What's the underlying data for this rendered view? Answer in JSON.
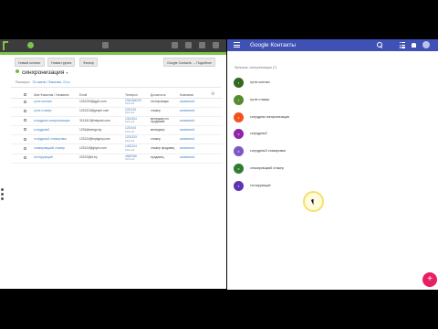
{
  "crm": {
    "buttons": {
      "new_contact": "Новый контакт",
      "new_segment": "Новая группа",
      "filter": "Фильтр",
      "google_sync": "Google Contacts → Подобное"
    },
    "title": "синхронизация",
    "subtitle_label": "Расширил",
    "subtitle_link": "По имени / Фамилии, 24 ст.",
    "columns": [
      "Имя Фамилия / Название",
      "Email",
      "Телефон",
      "Должность",
      "Компания"
    ],
    "rows": [
      {
        "name": "гугле контакт",
        "email": "1231233@gg1l.com",
        "phone": "2342466767",
        "phone_type": "Рабочий",
        "job": "тестировщик",
        "company": "компания1"
      },
      {
        "name": "гугле стажер",
        "email": "1231313@gmym.com",
        "phone": "123/133",
        "phone_type": "Рабочий",
        "job": "стажер",
        "company": "компания1"
      },
      {
        "name": "сотрудник синхронизация",
        "email": "3113413@mkpmk.com",
        "phone": "1341344",
        "phone_type": "Рабочий",
        "job": "менеджер по продажам",
        "company": "компания1"
      },
      {
        "name": "сотрудник2",
        "email": "1234@mmga.by",
        "phone": "123/144",
        "phone_type": "Рабочий",
        "job": "менеджер",
        "company": "компания1"
      },
      {
        "name": "сотрудник3 стажировки",
        "email": "123124@mykgmy.com",
        "phone": "1231233",
        "phone_type": "Рабочий",
        "job": "стажер",
        "company": "компания1"
      },
      {
        "name": "стажировщик5 стажер",
        "email": "123124@ghym.com",
        "phone": "1432124",
        "phone_type": "Рабочий",
        "job": "стажер продавец",
        "company": "компания1"
      },
      {
        "name": "тестирующий",
        "email": "22222@br.by",
        "phone": "4565766",
        "phone_type": "Рабочий",
        "job": "продавец",
        "company": "компания1"
      }
    ]
  },
  "gc": {
    "app_title_brand": "Google",
    "app_title_product": "Контакты",
    "section_title": "Ярлыков: синхронизация (7)",
    "contacts": [
      {
        "initial": "г",
        "name": "гугле контакт",
        "color": "#33691e"
      },
      {
        "initial": "г",
        "name": "гугле стажер",
        "color": "#558b2f"
      },
      {
        "initial": "с",
        "name": "сотрудник синхронизация",
        "color": "#f4511e"
      },
      {
        "initial": "с",
        "name": "сотрудник2",
        "color": "#8e24aa"
      },
      {
        "initial": "с",
        "name": "сотрудник3 стажировки",
        "color": "#7e57c2"
      },
      {
        "initial": "с",
        "name": "стажировщик5 стажер",
        "color": "#2e7d32"
      },
      {
        "initial": "т",
        "name": "тестирующий",
        "color": "#5e35b1"
      }
    ],
    "fab_label": "+"
  }
}
